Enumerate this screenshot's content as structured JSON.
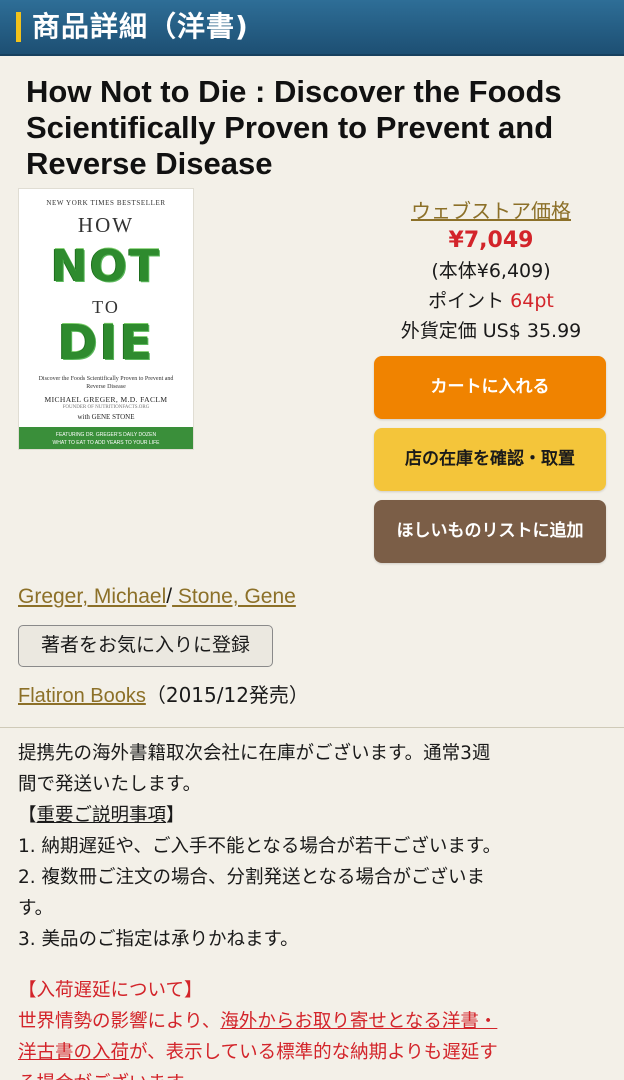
{
  "header": {
    "title": "商品詳細（洋書)"
  },
  "book": {
    "title": "How Not to Die : Discover the Foods Scientifically Proven to Prevent and Reverse Disease",
    "cover": {
      "bestseller": "NEW YORK TIMES BESTSELLER",
      "word_how": "HOW",
      "word_not": "NOT",
      "word_to": "TO",
      "word_die": "DIE",
      "subtitle": "Discover the Foods Scientifically Proven to Prevent and Reverse Disease",
      "author_main": "MICHAEL GREGER, M.D. FACLM",
      "author_note": "FOUNDER OF NUTRITIONFACTS.ORG",
      "author_with": "with GENE STONE",
      "band_line1": "FEATURING DR. GREGER'S DAILY DOZEN",
      "band_line2": "WHAT TO EAT TO ADD YEARS TO YOUR LIFE"
    }
  },
  "price": {
    "store_label": "ウェブストア価格",
    "price": "¥7,049",
    "base_price": "(本体¥6,409)",
    "points_label": "ポイント ",
    "points_value": "64pt",
    "foreign_price": "外貨定価 US$ 35.99"
  },
  "buttons": {
    "cart": "カートに入れる",
    "store_stock": "店の在庫を確認・取置",
    "wishlist": "ほしいものリストに追加",
    "favorite_author": "著者をお気に入りに登録"
  },
  "authors": {
    "author1": "Greger, Michael",
    "separator": "/",
    "author2": " Stone, Gene"
  },
  "publisher": {
    "name": "Flatiron Books",
    "date": "（2015/12発売）"
  },
  "notice": {
    "line1": "提携先の海外書籍取次会社に在庫がございます。通常3週",
    "line2": "間で発送いたします。",
    "important_open": "【",
    "important_text": "重要ご説明事項",
    "important_close": "】",
    "item1": "1. 納期遅延や、ご入手不能となる場合が若干ございます。",
    "item2a": "2. 複数冊ご注文の場合、分割発送となる場合がございま",
    "item2b": "す。",
    "item3": "3. 美品のご指定は承りかねます。",
    "delay_heading": "【入荷遅延について】",
    "delay_a": "世界情勢の影響により、",
    "delay_link1": "海外からお取り寄せとなる洋書・",
    "delay_link2": "洋古書の入荷",
    "delay_b": "が、表示している標準的な納期よりも遅延す",
    "delay_c": "る場合がございます。"
  }
}
